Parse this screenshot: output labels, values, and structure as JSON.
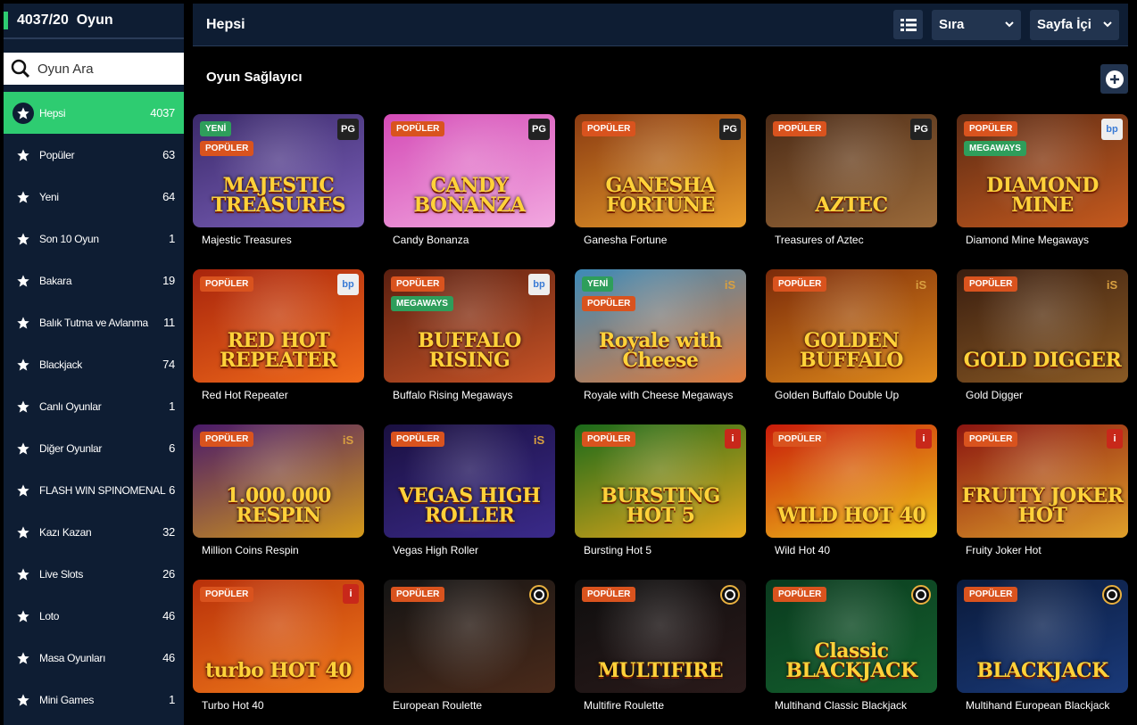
{
  "sidebar": {
    "header": "4037/20  Oyun",
    "search_placeholder": "Oyun Ara",
    "categories": [
      {
        "label": "Hepsi",
        "count": "4037",
        "active": true
      },
      {
        "label": "Popüler",
        "count": "63"
      },
      {
        "label": "Yeni",
        "count": "64"
      },
      {
        "label": "Son 10 Oyun",
        "count": "1"
      },
      {
        "label": "Bakara",
        "count": "19"
      },
      {
        "label": "Balık Tutma ve Avlanma",
        "count": "11"
      },
      {
        "label": "Blackjack",
        "count": "74"
      },
      {
        "label": "Canlı Oyunlar",
        "count": "1"
      },
      {
        "label": "Diğer Oyunlar",
        "count": "6"
      },
      {
        "label": "FLASH WIN SPINOMENAL",
        "count": "6"
      },
      {
        "label": "Kazı Kazan",
        "count": "32"
      },
      {
        "label": "Live Slots",
        "count": "26"
      },
      {
        "label": "Loto",
        "count": "46"
      },
      {
        "label": "Masa Oyunları",
        "count": "46"
      },
      {
        "label": "Mini Games",
        "count": "1"
      }
    ]
  },
  "topbar": {
    "title": "Hepsi",
    "sort_label": "Sıra",
    "page_label": "Sayfa İçi"
  },
  "section_title": "Oyun Sağlayıcı",
  "games": [
    {
      "name": "Majestic Treasures",
      "art_title": "MAJESTIC TREASURES",
      "badges": [
        "YENİ",
        "POPÜLER"
      ],
      "provider": "PG",
      "bg": "#3b2a6b",
      "bg2": "#7a5fb8"
    },
    {
      "name": "Candy Bonanza",
      "art_title": "CANDY BONANZA",
      "badges": [
        "POPÜLER"
      ],
      "provider": "PG",
      "bg": "#d44bb6",
      "bg2": "#f2a8e0"
    },
    {
      "name": "Ganesha Fortune",
      "art_title": "GANESHA FORTUNE",
      "badges": [
        "POPÜLER"
      ],
      "provider": "PG",
      "bg": "#8a3b12",
      "bg2": "#e89b2a"
    },
    {
      "name": "Treasures of Aztec",
      "art_title": "AZTEC",
      "badges": [
        "POPÜLER"
      ],
      "provider": "PG",
      "bg": "#4a2a16",
      "bg2": "#9b6a3a"
    },
    {
      "name": "Diamond Mine Megaways",
      "art_title": "DIAMOND MINE",
      "badges": [
        "POPÜLER",
        "MEGAWAYS"
      ],
      "provider": "bp",
      "bg": "#5a2a14",
      "bg2": "#c65a1e"
    },
    {
      "name": "Red Hot Repeater",
      "art_title": "RED HOT REPEATER",
      "badges": [
        "POPÜLER"
      ],
      "provider": "bp",
      "bg": "#a8240c",
      "bg2": "#f06a1a"
    },
    {
      "name": "Buffalo Rising Megaways",
      "art_title": "BUFFALO RISING",
      "badges": [
        "POPÜLER",
        "MEGAWAYS"
      ],
      "provider": "bp",
      "bg": "#5a1f10",
      "bg2": "#c65326"
    },
    {
      "name": "Royale with Cheese Megaways",
      "art_title": "Royale with Cheese",
      "badges": [
        "YENİ",
        "POPÜLER"
      ],
      "provider": "iS",
      "bg": "#3d8ab8",
      "bg2": "#e07a3a"
    },
    {
      "name": "Golden Buffalo Double Up",
      "art_title": "GOLDEN BUFFALO",
      "badges": [
        "POPÜLER"
      ],
      "provider": "iS",
      "bg": "#7a2a0a",
      "bg2": "#e08a1a"
    },
    {
      "name": "Gold Digger",
      "art_title": "GOLD DIGGER",
      "badges": [
        "POPÜLER"
      ],
      "provider": "iS",
      "bg": "#3a1e10",
      "bg2": "#8a5a24"
    },
    {
      "name": "Million Coins Respin",
      "art_title": "1.000.000 RESPIN",
      "badges": [
        "POPÜLER"
      ],
      "provider": "iS",
      "bg": "#4a1a6a",
      "bg2": "#d49a1a"
    },
    {
      "name": "Vegas High Roller",
      "art_title": "VEGAS HIGH ROLLER",
      "badges": [
        "POPÜLER"
      ],
      "provider": "iS",
      "bg": "#1a1040",
      "bg2": "#3a2a8a"
    },
    {
      "name": "Bursting Hot 5",
      "art_title": "BURSTING HOT 5",
      "badges": [
        "POPÜLER"
      ],
      "provider": "i",
      "bg": "#1a6a1a",
      "bg2": "#e8a81a"
    },
    {
      "name": "Wild Hot 40",
      "art_title": "WILD HOT 40",
      "badges": [
        "POPÜLER"
      ],
      "provider": "i",
      "bg": "#c81a0a",
      "bg2": "#f0c81a"
    },
    {
      "name": "Fruity Joker Hot",
      "art_title": "FRUITY JOKER HOT",
      "badges": [
        "POPÜLER"
      ],
      "provider": "i",
      "bg": "#8a1410",
      "bg2": "#e0a02a"
    },
    {
      "name": "Turbo Hot 40",
      "art_title": "turbo HOT 40",
      "badges": [
        "POPÜLER"
      ],
      "provider": "i",
      "bg": "#b8300a",
      "bg2": "#f07a1a"
    },
    {
      "name": "European Roulette",
      "art_title": "",
      "badges": [
        "POPÜLER"
      ],
      "provider": "ring",
      "bg": "#141414",
      "bg2": "#4a2a1a"
    },
    {
      "name": "Multifire Roulette",
      "art_title": "MULTIFIRE",
      "badges": [
        "POPÜLER"
      ],
      "provider": "ring",
      "bg": "#0e0e0e",
      "bg2": "#2a1a1a"
    },
    {
      "name": "Multihand Classic Blackjack",
      "art_title": "Classic BLACKJACK",
      "badges": [
        "POPÜLER"
      ],
      "provider": "ring",
      "bg": "#0a3a1e",
      "bg2": "#14602e"
    },
    {
      "name": "Multihand European Blackjack",
      "art_title": "BLACKJACK",
      "badges": [
        "POPÜLER"
      ],
      "provider": "ring",
      "bg": "#0a1a3a",
      "bg2": "#1a3a7a"
    }
  ]
}
